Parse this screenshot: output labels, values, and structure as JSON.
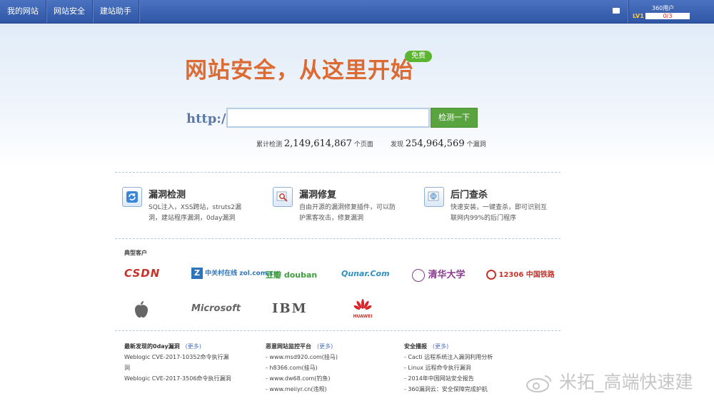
{
  "nav": [
    "我的网站",
    "网站安全",
    "建站助手"
  ],
  "user": {
    "name": "360用户",
    "level": "LV1",
    "progress": "0/3"
  },
  "hero": {
    "title": "网站安全，从这里开始",
    "badge": "免费"
  },
  "scan": {
    "prefix": "http://",
    "placeholder": "",
    "button": "检测一下"
  },
  "stats": [
    {
      "label": "累计检测",
      "value": "2,149,614,867",
      "unit": "个页面"
    },
    {
      "label": "发现",
      "value": "254,964,569",
      "unit": "个漏洞"
    }
  ],
  "features": [
    {
      "title": "漏洞检测",
      "desc": "SQL注入，XSS跨站，struts2漏洞，建站程序漏洞，0day漏洞",
      "icon": "refresh-icon"
    },
    {
      "title": "漏洞修复",
      "desc": "自由开源的漏洞修复插件，可以防护黑客攻击，修复漏洞",
      "icon": "magnifier-icon"
    },
    {
      "title": "后门查杀",
      "desc": "快速安装，一键查杀，即可识别互联网内99%的后门程序",
      "icon": "fingerprint-icon"
    }
  ],
  "customers": {
    "title": "典型客户",
    "logos": [
      "CSDN",
      "中关村在线 zol.com.cn",
      "豆瓣 douban",
      "Qunar.Com",
      "清华大学",
      "12306 中国铁路",
      "Apple",
      "Microsoft",
      "IBM",
      "HUAWEI"
    ]
  },
  "columns": [
    {
      "title": "最新发现的0day漏洞",
      "more": "(更多)",
      "items": [
        "Weblogic CVE-2017-10352命令执行漏洞",
        "Weblogic CVE-2017-3506命令执行漏洞"
      ]
    },
    {
      "title": "恶意网站监控平台",
      "more": "(更多)",
      "items": [
        "- www.msd920.com(挂马)",
        "- h8366.com(挂马)",
        "- www.dw68.com(钓鱼)",
        "- www.meiiyr.cn(违规)"
      ]
    },
    {
      "title": "安全播报",
      "more": "(更多)",
      "items": [
        "- Cacti 远程系统注入漏洞利用分析",
        "- Linux 远程命令执行漏洞",
        "- 2014年中国网站安全报告",
        "- 360漏洞云：安全保障完成护航"
      ]
    }
  ],
  "watermark": "米拓_高端快速建"
}
